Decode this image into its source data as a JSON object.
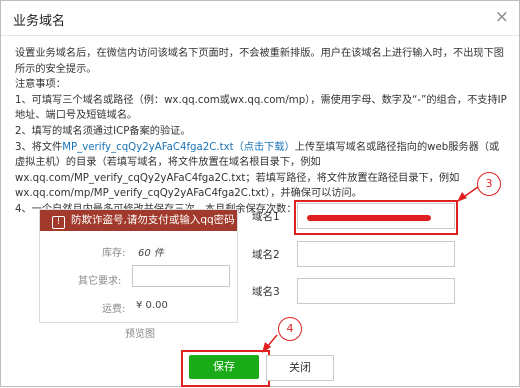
{
  "dialog": {
    "title": "业务域名",
    "close_glyph": "×",
    "intro": "设置业务域名后，在微信内访问该域名下页面时，不会被重新排版。用户在该域名上进行输入时，不出现下图所示的安全提示。",
    "notes_heading": "注意事项：",
    "note1": "1、可填写三个域名或路径（例：wx.qq.com或wx.qq.com/mp），需使用字母、数字及“-”的组合，不支持IP地址、端口号及短链域名。",
    "note2": "2、填写的域名须通过ICP备案的验证。",
    "note3_prefix": "3、将文件",
    "note3_link": "MP_verify_cqQy2yAFaC4fga2C.txt（点击下载）",
    "note3_suffix": "上传至填写域名或路径指向的web服务器（或虚拟主机）的目录（若填写域名，将文件放置在域名根目录下，例如wx.qq.com/MP_verify_cqQy2yAFaC4fga2C.txt；若填写路径，将文件放置在路径目录下，例如wx.qq.com/mp/MP_verify_cqQy2yAFaC4fga2C.txt），并确保可以访问。",
    "note4_prefix": "4、一个自然月内最多可修改并保存三次，本月剩余保存次数：",
    "note4_count": "2"
  },
  "preview": {
    "warning": "防欺诈盗号,请勿支付或输入qq密码",
    "warning_icon": "!",
    "stock_label": "库存:",
    "stock_value": "60 件",
    "other_label": "其它要求:",
    "shipping_label": "运费:",
    "shipping_value": "¥ 0.00",
    "caption": "预览图"
  },
  "domains": {
    "label1": "域名1",
    "label2": "域名2",
    "label3": "域名3"
  },
  "callouts": {
    "c3": "3",
    "c4": "4"
  },
  "buttons": {
    "save": "保存",
    "close": "关闭"
  },
  "colors": {
    "save_green": "#1aab19",
    "annotation_red": "#e02020",
    "warning_bg": "#a13a2c",
    "link_blue": "#1a73b7"
  }
}
